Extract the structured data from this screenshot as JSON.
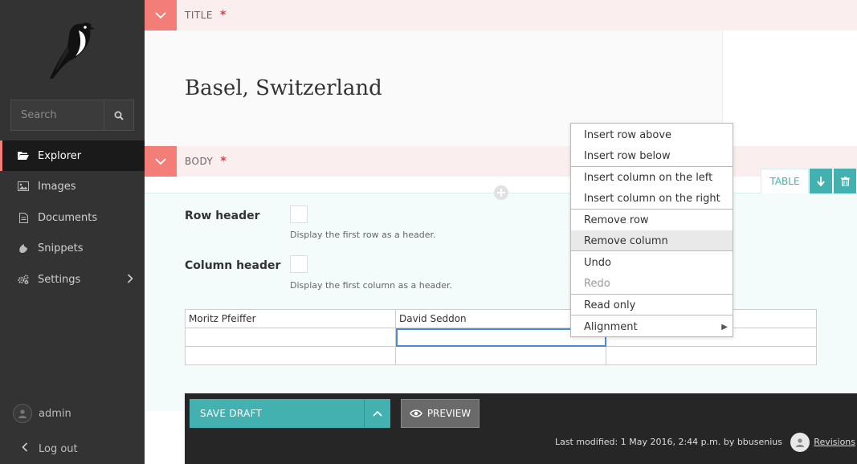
{
  "sidebar": {
    "search_placeholder": "Search",
    "items": [
      {
        "label": "Explorer",
        "icon": "folder-open-icon"
      },
      {
        "label": "Images",
        "icon": "image-icon"
      },
      {
        "label": "Documents",
        "icon": "document-icon"
      },
      {
        "label": "Snippets",
        "icon": "snippet-icon"
      },
      {
        "label": "Settings",
        "icon": "cogs-icon"
      }
    ],
    "account": "admin",
    "logout": "Log out"
  },
  "title_section": {
    "label": "TITLE",
    "required": "*",
    "value": "Basel, Switzerland"
  },
  "body_section": {
    "label": "BODY",
    "required": "*",
    "block_type": "TABLE"
  },
  "table_options": {
    "row_header_label": "Row header",
    "row_header_help": "Display the first row as a header.",
    "column_header_label": "Column header",
    "column_header_help": "Display the first column as a header."
  },
  "table": {
    "rows": [
      [
        "Moritz Pfeiffer",
        "David Seddon",
        ""
      ],
      [
        "",
        "",
        ""
      ],
      [
        "",
        "",
        ""
      ]
    ]
  },
  "context_menu": {
    "items": [
      "Insert row above",
      "Insert row below",
      "Insert column on the left",
      "Insert column on the right",
      "Remove row",
      "Remove column",
      "Undo",
      "Redo",
      "Read only",
      "Alignment"
    ],
    "submenu_arrow": "▶"
  },
  "footer": {
    "save_label": "SAVE DRAFT",
    "preview_label": "PREVIEW",
    "last_modified": "Last modified: 1 May 2016, 2:44 p.m. by bbusenius",
    "revisions": "Revisions"
  },
  "colors": {
    "sidebar_bg": "#333333",
    "accent_teal": "#43b1b0",
    "accent_salmon": "#f37e77",
    "footer_bg": "#262626"
  }
}
